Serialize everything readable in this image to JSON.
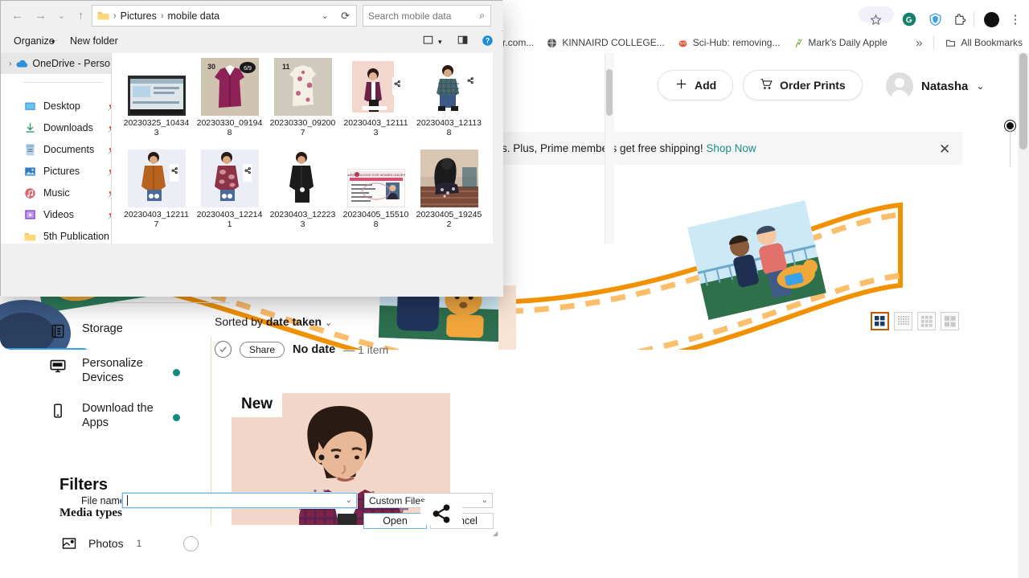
{
  "browser": {
    "toolbar_icons": [
      {
        "name": "bookmark-star-icon",
        "glyph": "☆"
      },
      {
        "name": "grammarly-extension-icon",
        "glyph": "G"
      },
      {
        "name": "zenmate-vpn-extension-icon",
        "glyph": "V"
      },
      {
        "name": "extensions-puzzle-icon",
        "glyph": "⬠"
      },
      {
        "name": "profile-avatar-icon",
        "glyph": "●"
      },
      {
        "name": "chrome-menu-icon",
        "glyph": "⋮"
      }
    ],
    "bookmarks": [
      {
        "label": "eoplePerHour.com...",
        "favicon": "peopleperhour-favicon",
        "color": "#ffffff",
        "glyph": ""
      },
      {
        "label": "KINNAIRD COLLEGE...",
        "favicon": "globe-favicon",
        "color": "#4a4a4a",
        "glyph": "🌐"
      },
      {
        "label": "Sci-Hub: removing...",
        "favicon": "scihub-favicon",
        "color": "#e8552d",
        "glyph": "👹"
      },
      {
        "label": "Mark's Daily Apple",
        "favicon": "marksdailyapple-favicon",
        "color": "#7cb342",
        "glyph": "🏃"
      }
    ],
    "overflow_label": "»",
    "all_bookmarks_label": "All Bookmarks"
  },
  "photos_page": {
    "add_button": "Add",
    "order_prints_button": "Order Prints",
    "account_name": "Natasha",
    "promo": {
      "text": "s. Plus, Prime members get free shipping!",
      "link": "Shop Now",
      "close": "✕"
    },
    "nav": [
      {
        "label": "Storage",
        "icon": "storage-icon",
        "dot": false
      },
      {
        "label": "Personalize Devices",
        "icon": "monitor-icon",
        "dot": true
      },
      {
        "label": "Download the Apps",
        "icon": "phone-icon",
        "dot": true
      }
    ],
    "filters_heading": "Filters",
    "media_types_heading": "Media types",
    "media_types": [
      {
        "label": "Photos",
        "count": "1"
      }
    ],
    "sort": {
      "prefix": "Sorted by ",
      "value": "date taken",
      "caret": "⌄"
    },
    "group": {
      "share_label": "Share",
      "title": "No date",
      "meta": "— 1 item",
      "check": "✓"
    },
    "view_modes": [
      {
        "name": "view-mode-large",
        "active": true
      },
      {
        "name": "view-mode-tiny",
        "active": false
      },
      {
        "name": "view-mode-small",
        "active": false
      },
      {
        "name": "view-mode-medium",
        "active": false
      }
    ],
    "photo_tile": {
      "badge": "New"
    }
  },
  "dialog": {
    "nav_buttons": [
      {
        "name": "back-button",
        "glyph": "←"
      },
      {
        "name": "forward-button",
        "glyph": "→"
      },
      {
        "name": "recent-locations-button",
        "glyph": "⌄"
      },
      {
        "name": "up-button",
        "glyph": "↑"
      }
    ],
    "breadcrumb": [
      "Pictures",
      "mobile data"
    ],
    "address_caret": "⌄",
    "refresh_glyph": "⟳",
    "search_placeholder": "Search mobile data",
    "search_value": "",
    "search_icon": "⌕",
    "commands": {
      "organize": "Organize",
      "organize_caret": "▾",
      "new_folder": "New folder",
      "view_caret": "▾",
      "help_glyph": "?"
    },
    "tree": {
      "root": "OneDrive - Perso",
      "items": [
        {
          "label": "Desktop",
          "icon": "desktop-icon",
          "pinned": true
        },
        {
          "label": "Downloads",
          "icon": "download-icon",
          "pinned": true
        },
        {
          "label": "Documents",
          "icon": "document-icon",
          "pinned": true
        },
        {
          "label": "Pictures",
          "icon": "pictures-icon",
          "pinned": true
        },
        {
          "label": "Music",
          "icon": "music-icon",
          "pinned": true
        },
        {
          "label": "Videos",
          "icon": "video-icon",
          "pinned": true
        },
        {
          "label": "5th Publication",
          "icon": "folder-icon",
          "pinned": false
        }
      ]
    },
    "files": [
      {
        "name": "20230325_104343",
        "thumb": "screenshot"
      },
      {
        "name": "20230330_091948",
        "thumb": "magenta-shirt"
      },
      {
        "name": "20230330_092007",
        "thumb": "floral-shirt"
      },
      {
        "name": "20230403_121113",
        "thumb": "purple-check-shirt"
      },
      {
        "name": "20230403_121138",
        "thumb": "blue-check-shirt"
      },
      {
        "name": "20230403_122117",
        "thumb": "orange-kurta"
      },
      {
        "name": "20230403_122141",
        "thumb": "maroon-print-shirt"
      },
      {
        "name": "20230403_122233",
        "thumb": "black-shirt"
      },
      {
        "name": "20230405_155108",
        "thumb": "id-card"
      },
      {
        "name": "20230405_192452",
        "thumb": "person-prayer"
      }
    ],
    "file_name_label": "File name:",
    "file_name_value": "",
    "file_type_value": "Custom Files",
    "open_button": "Open",
    "cancel_button": "Cancel"
  }
}
